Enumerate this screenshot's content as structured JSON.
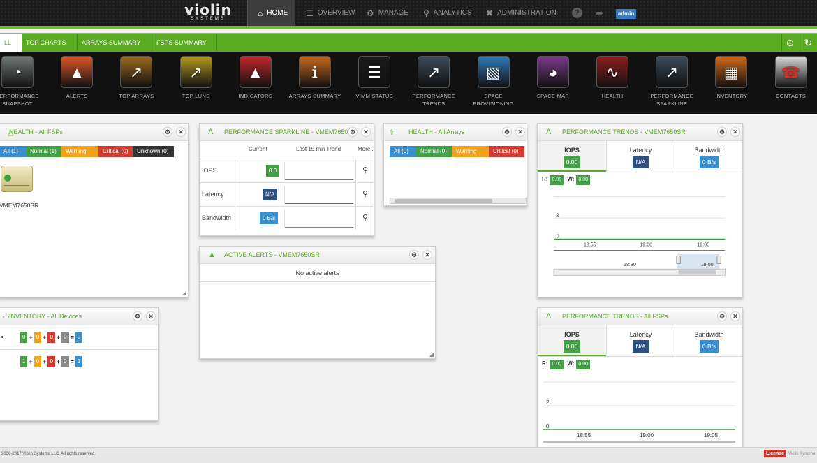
{
  "brand": {
    "name": "violin",
    "sub": "SYSTEMS"
  },
  "nav": {
    "home": "HOME",
    "overview": "OVERVIEW",
    "manage": "MANAGE",
    "analytics": "ANALYTICS",
    "administration": "ADMINISTRATION",
    "user": "admin"
  },
  "tabs": [
    "LL",
    "TOP CHARTS",
    "ARRAYS SUMMARY",
    "FSPS SUMMARY"
  ],
  "dashboards": [
    {
      "label": "PERFORMANCE SNAPSHOT",
      "icon": "gauge-icon",
      "color": "#6f7a78"
    },
    {
      "label": "ALERTS",
      "icon": "alert-icon",
      "color": "#e0572a"
    },
    {
      "label": "TOP ARRAYS",
      "icon": "top-arrays-icon",
      "color": "#9c6a1d"
    },
    {
      "label": "TOP LUNS",
      "icon": "top-luns-icon",
      "color": "#b59b1e"
    },
    {
      "label": "INDICATORS",
      "icon": "indicators-icon",
      "color": "#c2262d"
    },
    {
      "label": "ARRAYS SUMMARY",
      "icon": "arrays-summary-icon",
      "color": "#c8681c"
    },
    {
      "label": "VIMM STATUS",
      "icon": "vimm-status-icon",
      "color": "#1a1a1a"
    },
    {
      "label": "PERFORMANCE TRENDS",
      "icon": "performance-trends-icon",
      "color": "#3a4b58"
    },
    {
      "label": "SPACE PROVISIONING",
      "icon": "space-provisioning-icon",
      "color": "#2f79b7"
    },
    {
      "label": "SPACE MAP",
      "icon": "space-map-icon",
      "color": "#7a3a8a"
    },
    {
      "label": "HEALTH",
      "icon": "health-icon",
      "color": "#8e1f1f"
    },
    {
      "label": "PERFORMANCE SPARKLINE",
      "icon": "performance-sparkline-icon",
      "color": "#3a4b58"
    },
    {
      "label": "INVENTORY",
      "icon": "inventory-icon",
      "color": "#d46a1a"
    },
    {
      "label": "CONTACTS",
      "icon": "contacts-icon",
      "color": "#d9d9d9"
    }
  ],
  "health_fsps": {
    "title": "HEALTH - All FSPs",
    "filters": {
      "all": "All (1)",
      "normal": "Normal (1)",
      "warning": "Warning (0)",
      "critical": "Critical (0)",
      "unknown": "Unknown (0)"
    },
    "device": "VMEM7650SR"
  },
  "sparkline": {
    "title": "PERFORMANCE SPARKLINE - VMEM7650SR",
    "headers": {
      "current": "Current",
      "trend": "Last 15 min Trend",
      "more": "More.."
    },
    "rows": [
      {
        "label": "IOPS",
        "value": "0.0"
      },
      {
        "label": "Latency",
        "value": "N/A"
      },
      {
        "label": "Bandwidth",
        "value": "0 B/s"
      }
    ]
  },
  "health_arrays": {
    "title": "HEALTH - All Arrays",
    "filters": {
      "all": "All (0)",
      "normal": "Normal (0)",
      "warning": "Warning (0)",
      "critical": "Critical (0)"
    }
  },
  "alerts": {
    "title": "ACTIVE ALERTS - VMEM7650SR",
    "empty": "No active alerts"
  },
  "inventory": {
    "title": "INVENTORY - All Devices",
    "row1": {
      "label": "s",
      "values": [
        "0",
        "0",
        "0",
        "0",
        "0"
      ]
    },
    "row2": {
      "values": [
        "1",
        "0",
        "0",
        "0",
        "1"
      ]
    }
  },
  "trends_vmem": {
    "title": "PERFORMANCE TRENDS - VMEM7650SR",
    "tabs": {
      "iops": "IOPS",
      "iops_val": "0.00",
      "latency": "Latency",
      "latency_val": "N/A",
      "bandwidth": "Bandwidth",
      "bandwidth_val": "0 B/s"
    },
    "r_label": "R:",
    "r_val": "0.00",
    "w_label": "W:",
    "w_val": "0.00",
    "y_ticks": [
      "2",
      "0"
    ],
    "x_ticks": [
      "18:55",
      "19:00",
      "19:05"
    ],
    "nav_tick": "18:30",
    "nav_tick2": "19:00"
  },
  "trends_fsps": {
    "title": "PERFORMANCE TRENDS - All FSPs",
    "tabs": {
      "iops": "IOPS",
      "iops_val": "0.00",
      "latency": "Latency",
      "latency_val": "N/A",
      "bandwidth": "Bandwidth",
      "bandwidth_val": "0 B/s"
    },
    "r_label": "R:",
    "r_val": "0.00",
    "w_label": "W:",
    "w_val": "0.00",
    "y_ticks": [
      "2",
      "0"
    ],
    "x_ticks": [
      "18:55",
      "19:00",
      "19:05"
    ]
  },
  "footer": {
    "copyright": "2006-2017 Violin Systems LLC. All rights reserved.",
    "license": "License",
    "right": "Violin Sympho"
  }
}
